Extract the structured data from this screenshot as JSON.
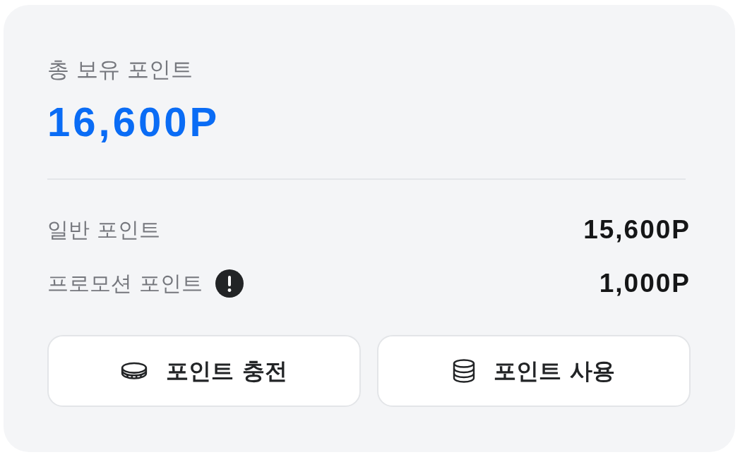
{
  "summary": {
    "label": "총 보유 포인트",
    "amount": "16,600P"
  },
  "breakdown": [
    {
      "label": "일반 포인트",
      "value": "15,600P",
      "info": false
    },
    {
      "label": "프로모션 포인트",
      "value": "1,000P",
      "info": true
    }
  ],
  "buttons": [
    {
      "label": "포인트 충전",
      "kind": "charge"
    },
    {
      "label": "포인트 사용",
      "kind": "use"
    }
  ]
}
